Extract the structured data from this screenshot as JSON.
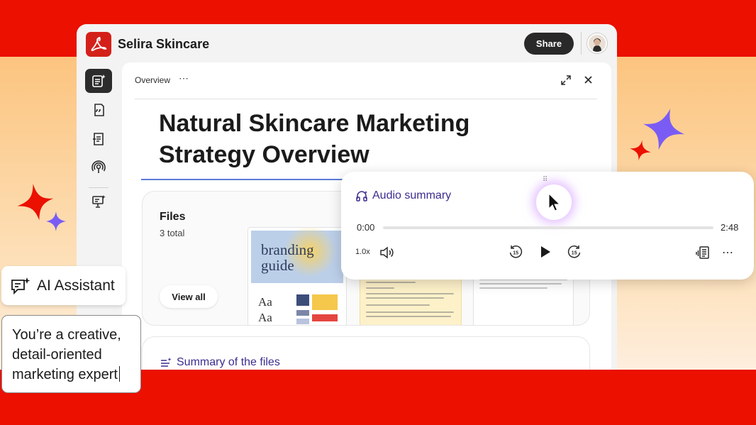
{
  "app": {
    "title": "Selira Skincare",
    "share_label": "Share"
  },
  "sidebar": {
    "items": [
      {
        "name": "ai-summary",
        "active": true
      },
      {
        "name": "quotes",
        "active": false
      },
      {
        "name": "document-list",
        "active": false
      },
      {
        "name": "podcast",
        "active": false
      },
      {
        "name": "presentation",
        "active": false
      }
    ]
  },
  "panel": {
    "header_label": "Overview",
    "more_label": "⋯",
    "document_title": "Natural Skincare Marketing Strategy Overview",
    "files": {
      "title": "Files",
      "count": "3 total",
      "view_all_label": "View all",
      "thumbnail_1": {
        "line1": "branding",
        "line2": "guide",
        "sample1": "Aa",
        "sample2": "Aa"
      }
    },
    "summary": {
      "title": "Summary of the files"
    }
  },
  "audio_player": {
    "title": "Audio summary",
    "drag_handle": "⠿",
    "time_current": "0:00",
    "time_total": "2:48",
    "speed": "1.0x",
    "progress": 0.0,
    "accent": "#3b2d8f"
  },
  "assistant": {
    "chip_label": "AI Assistant",
    "prompt_text": "You’re a creative, detail-oriented marketing expert"
  },
  "colors": {
    "brand_red": "#eb1000",
    "accent_purple": "#3b2d8f",
    "sparkle_purple": "#7a5cf5"
  }
}
